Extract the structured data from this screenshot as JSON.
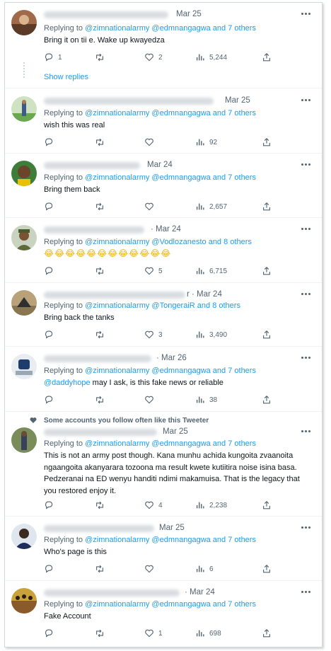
{
  "icons": {
    "reply": "reply-icon",
    "retweet": "retweet-icon",
    "like": "heart-icon",
    "views": "analytics-icon",
    "share": "share-icon",
    "more": "more-icon"
  },
  "colors": {
    "link": "#1d9bf0",
    "muted": "#536471",
    "text": "#0f1419"
  },
  "show_replies": "Show replies",
  "social_context": "Some accounts you follow often like this Tweeter",
  "replies": [
    {
      "date": "Mar 25",
      "replying_to": [
        "@zimnationalarmy",
        "@edmnangagwa and 7 others"
      ],
      "text": "Bring it on tii e. Wake up kwayedza",
      "counts": {
        "replies": "1",
        "retweets": "",
        "likes": "2",
        "views": "5,244"
      }
    },
    {
      "date": "Mar 25",
      "replying_to": [
        "@zimnationalarmy",
        "@edmnangagwa and 7 others"
      ],
      "text": "wish this was real",
      "counts": {
        "replies": "",
        "retweets": "",
        "likes": "",
        "views": "92"
      }
    },
    {
      "date": "Mar 24",
      "replying_to": [
        "@zimnationalarmy",
        "@edmnangagwa and 7 others"
      ],
      "text": "Bring them back",
      "counts": {
        "replies": "",
        "retweets": "",
        "likes": "",
        "views": "2,657"
      }
    },
    {
      "date": "· Mar 24",
      "replying_to": [
        "@zimnationalarmy",
        "@Vodlozanesto and 8 others"
      ],
      "text": "😂😂😂😂😂😂😂😂😂😂😂😂",
      "counts": {
        "replies": "",
        "retweets": "",
        "likes": "5",
        "views": "6,715"
      }
    },
    {
      "date": "r · Mar 24",
      "replying_to": [
        "@zimnationalarmy",
        "@TongeraiR and 8 others"
      ],
      "text": "Bring back the tanks",
      "counts": {
        "replies": "",
        "retweets": "",
        "likes": "3",
        "views": "3,490"
      }
    },
    {
      "date": "· Mar 26",
      "replying_to": [
        "@zimnationalarmy",
        "@edmnangagwa and 7 others"
      ],
      "mention": "@daddyhope",
      "text": " may I ask, is this fake news or reliable",
      "counts": {
        "replies": "",
        "retweets": "",
        "likes": "",
        "views": "38"
      }
    },
    {
      "date": "Mar 25",
      "replying_to": [
        "@zimnationalarmy",
        "@edmnangagwa and 7 others"
      ],
      "text": "This is not an army post though. Kana munhu achida kungoita zvaanoita ngaangoita akanyarara tozoona ma result kwete kutiitira noise isina basa. Pedzeranai na ED wenyu handiti ndimi makamuisa. That is the legacy that you restored enjoy it.",
      "counts": {
        "replies": "",
        "retweets": "",
        "likes": "4",
        "views": "2,238"
      }
    },
    {
      "date": "Mar 25",
      "replying_to": [
        "@zimnationalarmy",
        "@edmnangagwa and 7 others"
      ],
      "text": "Who's page is this",
      "counts": {
        "replies": "",
        "retweets": "",
        "likes": "",
        "views": "6"
      }
    },
    {
      "date": "· Mar 24",
      "replying_to": [
        "@zimnationalarmy",
        "@edmnangagwa and 7 others"
      ],
      "text": "Fake Account",
      "counts": {
        "replies": "",
        "retweets": "",
        "likes": "1",
        "views": "698"
      }
    }
  ],
  "replying_prefix": "Replying to"
}
